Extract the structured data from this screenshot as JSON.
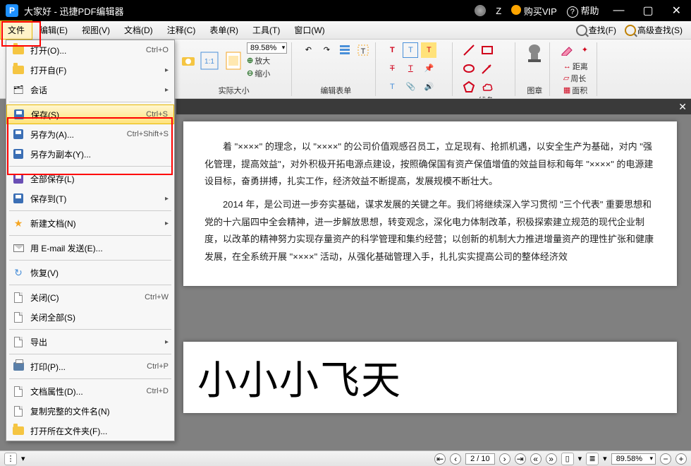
{
  "titlebar": {
    "title": "大家好 - 迅捷PDF编辑器",
    "user": "Z",
    "vip": "购买VIP",
    "help": "帮助"
  },
  "menubar": {
    "items": [
      "文件",
      "编辑(E)",
      "视图(V)",
      "文档(D)",
      "注释(C)",
      "表单(R)",
      "工具(T)",
      "窗口(W)"
    ],
    "find": "查找(F)",
    "advfind": "高级查找(S)"
  },
  "ribbon": {
    "zoom_value": "89.58%",
    "actual_size": "实际大小",
    "zoom_in": "放大",
    "zoom_out": "缩小",
    "edit_form": "编辑表单",
    "lines": "线条",
    "stamp": "图章",
    "distance": "距离",
    "perimeter": "周长",
    "area": "面积"
  },
  "filemenu": {
    "open": "打开(O)...",
    "open_sc": "Ctrl+O",
    "open_from": "打开自(F)",
    "session": "会话",
    "save": "保存(S)",
    "save_sc": "Ctrl+S",
    "save_as": "另存为(A)...",
    "save_as_sc": "Ctrl+Shift+S",
    "save_as_copy": "另存为副本(Y)...",
    "save_all": "全部保存(L)",
    "save_to": "保存到(T)",
    "new_doc": "新建文档(N)",
    "email": "用 E-mail 发送(E)...",
    "restore": "恢复(V)",
    "close": "关闭(C)",
    "close_sc": "Ctrl+W",
    "close_all": "关闭全部(S)",
    "export": "导出",
    "print": "打印(P)...",
    "print_sc": "Ctrl+P",
    "props": "文档属性(D)...",
    "props_sc": "Ctrl+D",
    "copy_name": "复制完整的文件名(N)",
    "open_folder": "打开所在文件夹(F)..."
  },
  "document": {
    "para1": "着 \"××××\" 的理念，以 \"××××\" 的公司价值观感召员工，立足现有、抢抓机遇，以安全生产为基础，对内 \"强化管理，提高效益\"，对外积极开拓电源点建设，按照确保国有资产保值增值的效益目标和每年 \"××××\" 的电源建设目标，奋勇拼搏，扎实工作，经济效益不断提高，发展规模不断壮大。",
    "para2": "2014 年，是公司进一步夯实基础，谋求发展的关键之年。我们将继续深入学习贯彻 \"三个代表\" 重要思想和党的十六届四中全会精神，进一步解放思想，转变观念，深化电力体制改革，积极探索建立规范的现代企业制度，以改革的精神努力实现存量资产的科学管理和集约经营；以创新的机制大力推进增量资产的理性扩张和健康发展，在全系统开展 \"××××\" 活动，从强化基础管理入手，扎扎实实提高公司的整体经济效",
    "bigtext": "小小小飞天"
  },
  "statusbar": {
    "page_current": "2",
    "page_total": "10",
    "zoom": "89.58%"
  }
}
